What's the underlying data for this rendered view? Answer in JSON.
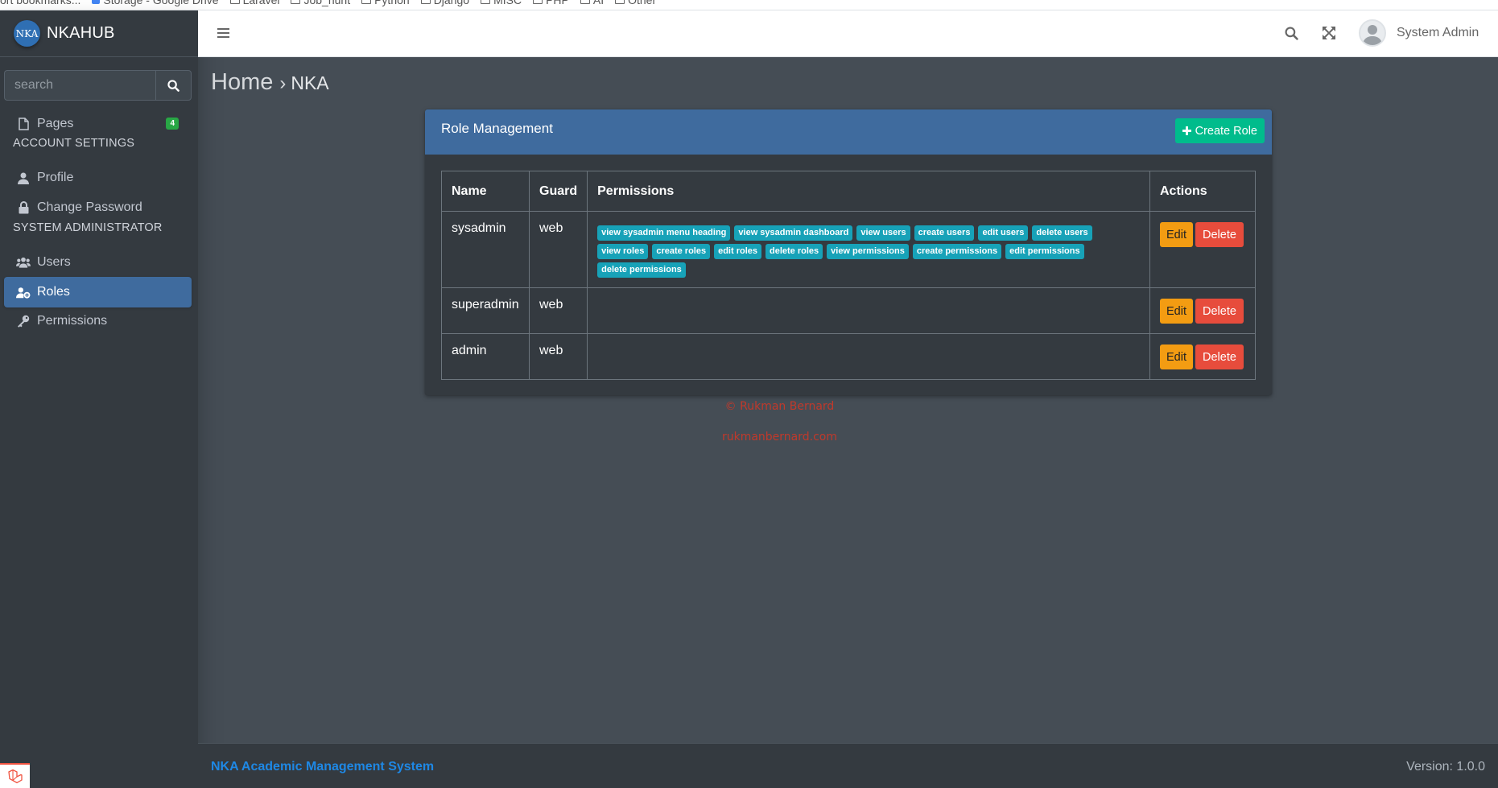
{
  "bookmarks": [
    "ort bookmarks...",
    "Storage - Google Drive",
    "Laravel",
    "Job_hunt",
    "Python",
    "Django",
    "MISC",
    "PHP",
    "AI",
    "Other"
  ],
  "brand": {
    "logo_text": "NKA",
    "name": "NKAHUB"
  },
  "search": {
    "placeholder": "search"
  },
  "sidebar": {
    "pages": {
      "label": "Pages",
      "badge": "4"
    },
    "account_header": "ACCOUNT SETTINGS",
    "profile": "Profile",
    "change_password": "Change Password",
    "sysadmin_header": "SYSTEM ADMINISTRATOR",
    "users": "Users",
    "roles": "Roles",
    "permissions": "Permissions"
  },
  "topbar": {
    "user_name": "System Admin"
  },
  "breadcrumb": {
    "home": "Home",
    "separator": "›",
    "current": "NKA"
  },
  "card": {
    "title": "Role Management",
    "create_label": "Create Role",
    "columns": [
      "Name",
      "Guard",
      "Permissions",
      "Actions"
    ],
    "rows": [
      {
        "name": "sysadmin",
        "guard": "web",
        "permissions": [
          "view sysadmin menu heading",
          "view sysadmin dashboard",
          "view users",
          "create users",
          "edit users",
          "delete users",
          "view roles",
          "create roles",
          "edit roles",
          "delete roles",
          "view permissions",
          "create permissions",
          "edit permissions",
          "delete permissions"
        ]
      },
      {
        "name": "superadmin",
        "guard": "web",
        "permissions": []
      },
      {
        "name": "admin",
        "guard": "web",
        "permissions": []
      }
    ],
    "edit_label": "Edit",
    "delete_label": "Delete"
  },
  "credit": {
    "copyright": "© Rukman Bernard",
    "site": "rukmanbernard.com"
  },
  "footer": {
    "app_name": "NKA Academic Management System",
    "version": "Version: 1.0.0"
  },
  "colors": {
    "sidebar": "#343a40",
    "content": "#454d55",
    "primary": "#3f6b9e",
    "success": "#00bc8c",
    "info": "#17a2b8",
    "warning": "#f39c12",
    "danger": "#e74c3c",
    "link": "#1e88e5"
  }
}
